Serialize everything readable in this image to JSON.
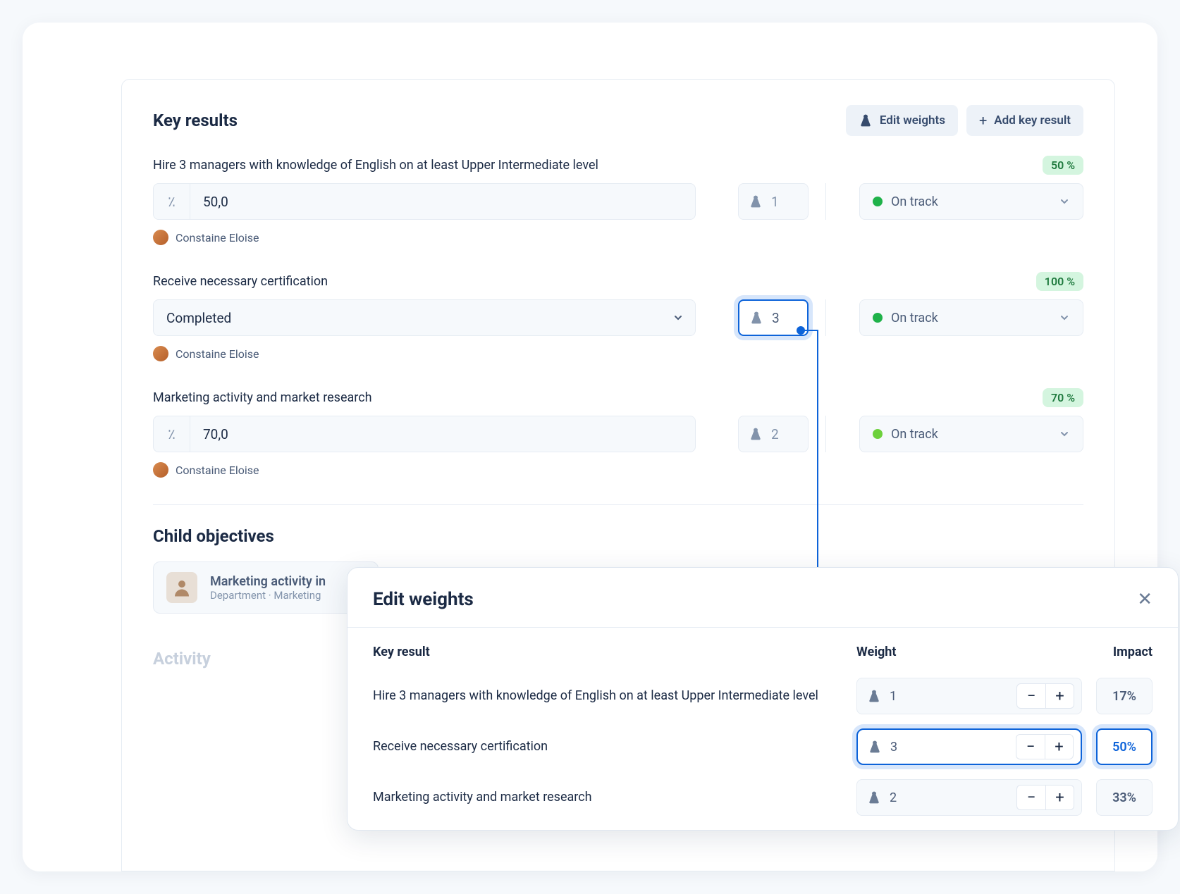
{
  "header": {
    "title": "Key results",
    "edit_weights": "Edit weights",
    "add_key_result": "Add key result"
  },
  "key_results": [
    {
      "title": "Hire 3 managers with knowledge of English on at least Upper Intermediate level",
      "percent": "50 %",
      "value": "50,0",
      "weight": "1",
      "status": "On track",
      "owner": "Constaine Eloise",
      "value_type": "percent",
      "highlight_weight": false,
      "status_tone": "green"
    },
    {
      "title": "Receive necessary certification",
      "percent": "100 %",
      "value": "Completed",
      "weight": "3",
      "status": "On track",
      "owner": "Constaine Eloise",
      "value_type": "select",
      "highlight_weight": true,
      "status_tone": "green"
    },
    {
      "title": "Marketing activity and market research",
      "percent": "70 %",
      "value": "70,0",
      "weight": "2",
      "status": "On track",
      "owner": "Constaine Eloise",
      "value_type": "percent",
      "highlight_weight": false,
      "status_tone": "lime"
    }
  ],
  "child_section": {
    "title": "Child objectives",
    "card": {
      "title": "Marketing activity in",
      "subtitle": "Department · Marketing"
    }
  },
  "activity_section": {
    "title": "Activity"
  },
  "modal": {
    "title": "Edit weights",
    "col_key_result": "Key result",
    "col_weight": "Weight",
    "col_impact": "Impact",
    "rows": [
      {
        "name": "Hire 3 managers with knowledge of English on at least Upper Intermediate level",
        "weight": "1",
        "impact": "17%",
        "highlight": false
      },
      {
        "name": "Receive necessary certification",
        "weight": "3",
        "impact": "50%",
        "highlight": true
      },
      {
        "name": "Marketing activity and market research",
        "weight": "2",
        "impact": "33%",
        "highlight": false
      }
    ]
  }
}
